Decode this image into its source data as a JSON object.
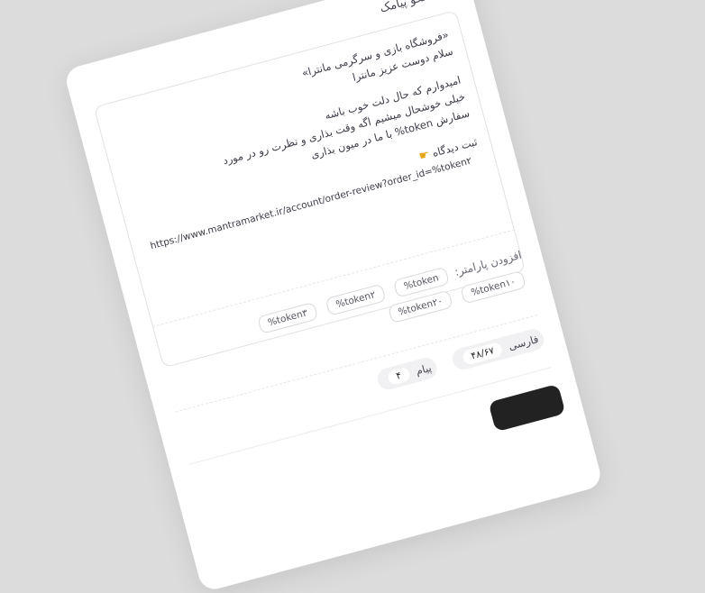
{
  "card": {
    "title": "متن الگو پیامک"
  },
  "message": {
    "line1": "«فروشگاه بازی و سرگرمی مانترا»",
    "line2": "سلام دوست عزیز مانترا",
    "line3": "امیدوارم که حال دلت خوب باشه",
    "line4": "خیلی خوشحال میشیم اگه وقت بذاری و نظرت رو در مورد",
    "line5": "سفارش token% با ما در میون بذاری",
    "line6": "ثبت دیدگاه",
    "url": "https://www.mantramarket.ir/account/order-review?order_id=%token۲"
  },
  "params": {
    "label": "افزودن پارامتر:",
    "chips": [
      "%token",
      "%token۲",
      "%token۳",
      "%token۱۰",
      "%token۲۰"
    ]
  },
  "stats": {
    "farsi_label": "فارسی",
    "farsi_count": "۴۸/۶۷",
    "sms_label": "پیام",
    "sms_count": "۴"
  }
}
